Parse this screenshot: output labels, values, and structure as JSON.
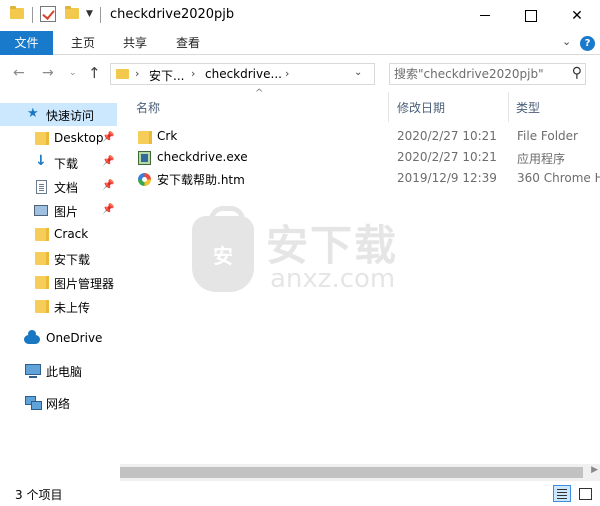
{
  "window": {
    "title": "checkdrive2020pjb"
  },
  "ribbon": {
    "tabs": [
      "文件",
      "主页",
      "共享",
      "查看"
    ]
  },
  "address": {
    "crumbs": [
      "安下...",
      "checkdrive..."
    ],
    "search_placeholder": "搜索\"checkdrive2020pjb\""
  },
  "nav": {
    "quick_access": "快速访问",
    "items": [
      {
        "label": "Desktop",
        "icon": "folder-icon",
        "pinned": true
      },
      {
        "label": "下载",
        "icon": "download-icon",
        "pinned": true
      },
      {
        "label": "文档",
        "icon": "document-icon",
        "pinned": true
      },
      {
        "label": "图片",
        "icon": "pictures-icon",
        "pinned": true
      },
      {
        "label": "Crack",
        "icon": "folder-icon",
        "pinned": false
      },
      {
        "label": "安下载",
        "icon": "folder-icon",
        "pinned": false
      },
      {
        "label": "图片管理器",
        "icon": "folder-icon",
        "pinned": false
      },
      {
        "label": "未上传",
        "icon": "folder-icon",
        "pinned": false
      }
    ],
    "onedrive": "OneDrive",
    "this_pc": "此电脑",
    "network": "网络"
  },
  "columns": {
    "name": "名称",
    "date": "修改日期",
    "type": "类型"
  },
  "files": [
    {
      "name": "Crk",
      "date": "2020/2/27 10:21",
      "type": "File Folder",
      "icon": "folder-icon"
    },
    {
      "name": "checkdrive.exe",
      "date": "2020/2/27 10:21",
      "type": "应用程序",
      "icon": "exe-icon"
    },
    {
      "name": "安下载帮助.htm",
      "date": "2019/12/9 12:39",
      "type": "360 Chrome H",
      "icon": "html-icon"
    }
  ],
  "watermark": {
    "badge": "安",
    "text": "安下载",
    "url": "anxz.com"
  },
  "status": {
    "count": "3 个项目"
  }
}
